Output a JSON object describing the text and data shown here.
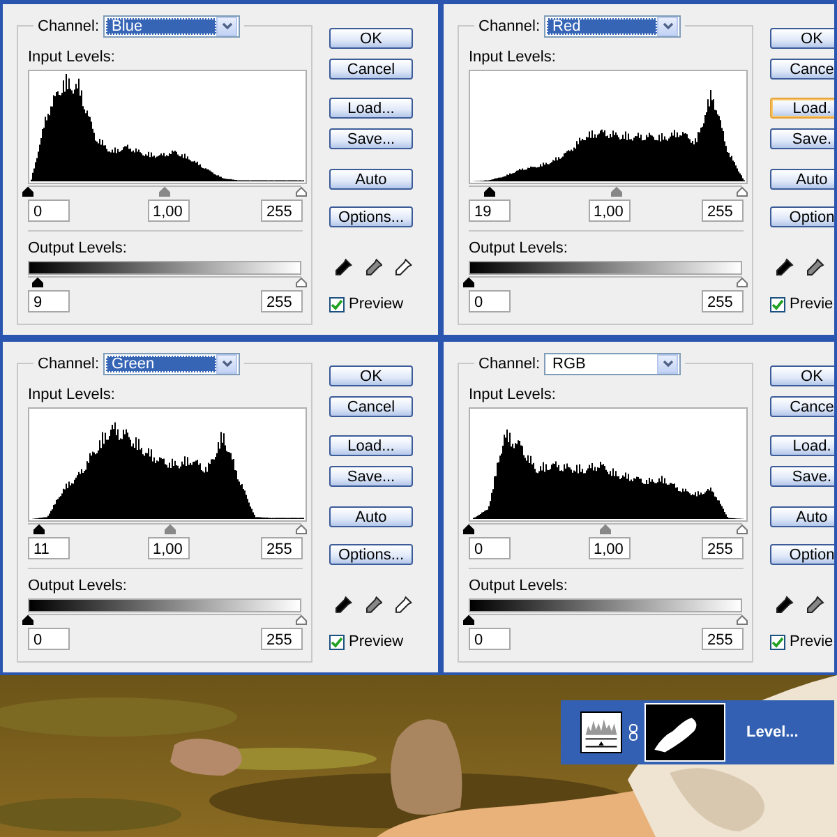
{
  "dialogs": [
    {
      "channel": {
        "label": "Channel:",
        "value": "Blue",
        "highlighted": true
      },
      "input_label": "Input Levels:",
      "input": [
        {
          "value": "0",
          "level": 0
        },
        {
          "value": "1,00",
          "level": 0.5
        },
        {
          "value": "255",
          "level": 1
        }
      ],
      "output_label": "Output Levels:",
      "output": [
        {
          "value": "9",
          "level": 0.035
        },
        {
          "value": "255",
          "level": 1
        }
      ],
      "buttons": [
        {
          "label": "OK",
          "hovered": false
        },
        {
          "label": "Cancel",
          "hovered": false
        },
        {
          "label": "Load...",
          "hovered": false
        },
        {
          "label": "Save...",
          "hovered": false
        },
        {
          "label": "Auto",
          "hovered": false
        },
        {
          "label": "Options...",
          "hovered": false
        }
      ],
      "eyedroppers": [
        {
          "kind": "black"
        },
        {
          "kind": "gray"
        },
        {
          "kind": "white"
        }
      ],
      "preview": {
        "label": "Preview",
        "checked": true
      }
    },
    {
      "channel": {
        "label": "Channel:",
        "value": "Red",
        "highlighted": true
      },
      "input_label": "Input Levels:",
      "input": [
        {
          "value": "19",
          "level": 0.075
        },
        {
          "value": "1,00",
          "level": 0.54
        },
        {
          "value": "255",
          "level": 1
        }
      ],
      "output_label": "Output Levels:",
      "output": [
        {
          "value": "0",
          "level": 0
        },
        {
          "value": "255",
          "level": 1
        }
      ],
      "buttons": [
        {
          "label": "OK",
          "hovered": false
        },
        {
          "label": "Cance",
          "hovered": false
        },
        {
          "label": "Load.",
          "hovered": true
        },
        {
          "label": "Save.",
          "hovered": false
        },
        {
          "label": "Auto",
          "hovered": false
        },
        {
          "label": "Option",
          "hovered": false
        }
      ],
      "eyedroppers": [
        {
          "kind": "black"
        },
        {
          "kind": "gray"
        }
      ],
      "preview": {
        "label": "Previe",
        "checked": true
      }
    },
    {
      "channel": {
        "label": "Channel:",
        "value": "Green",
        "highlighted": true
      },
      "input_label": "Input Levels:",
      "input": [
        {
          "value": "11",
          "level": 0.043
        },
        {
          "value": "1,00",
          "level": 0.52
        },
        {
          "value": "255",
          "level": 1
        }
      ],
      "output_label": "Output Levels:",
      "output": [
        {
          "value": "0",
          "level": 0
        },
        {
          "value": "255",
          "level": 1
        }
      ],
      "buttons": [
        {
          "label": "OK",
          "hovered": false
        },
        {
          "label": "Cancel",
          "hovered": false
        },
        {
          "label": "Load...",
          "hovered": false
        },
        {
          "label": "Save...",
          "hovered": false
        },
        {
          "label": "Auto",
          "hovered": false
        },
        {
          "label": "Options...",
          "hovered": false
        }
      ],
      "eyedroppers": [
        {
          "kind": "black"
        },
        {
          "kind": "gray"
        },
        {
          "kind": "white"
        }
      ],
      "preview": {
        "label": "Preview",
        "checked": true
      }
    },
    {
      "channel": {
        "label": "Channel:",
        "value": "RGB",
        "highlighted": false
      },
      "input_label": "Input Levels:",
      "input": [
        {
          "value": "0",
          "level": 0
        },
        {
          "value": "1,00",
          "level": 0.5
        },
        {
          "value": "255",
          "level": 1
        }
      ],
      "output_label": "Output Levels:",
      "output": [
        {
          "value": "0",
          "level": 0
        },
        {
          "value": "255",
          "level": 1
        }
      ],
      "buttons": [
        {
          "label": "OK",
          "hovered": false
        },
        {
          "label": "Cance",
          "hovered": false
        },
        {
          "label": "Load.",
          "hovered": false
        },
        {
          "label": "Save.",
          "hovered": false
        },
        {
          "label": "Auto",
          "hovered": false
        },
        {
          "label": "Option",
          "hovered": false
        }
      ],
      "eyedroppers": [
        {
          "kind": "black"
        },
        {
          "kind": "gray"
        }
      ],
      "preview": {
        "label": "Previe",
        "checked": true
      }
    }
  ],
  "layer": {
    "name": "Level...",
    "selected": true
  }
}
